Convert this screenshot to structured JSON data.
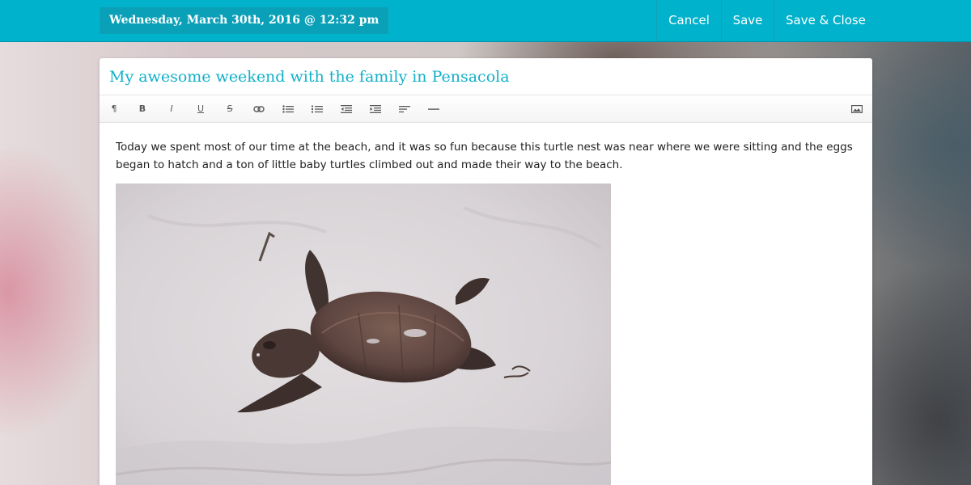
{
  "header": {
    "date": "Wednesday, March 30th, 2016 @ 12:32 pm",
    "cancel_label": "Cancel",
    "save_label": "Save",
    "save_close_label": "Save & Close",
    "accent_color": "#00b2cc"
  },
  "editor": {
    "title": "My awesome weekend with the family in Pensacola",
    "title_color": "#12b0c8",
    "toolbar": {
      "paragraph_glyph": "¶",
      "bold_glyph": "B",
      "italic_glyph": "I",
      "underline_glyph": "U",
      "strike_glyph": "S",
      "icons": [
        "paragraph-icon",
        "bold-icon",
        "italic-icon",
        "underline-icon",
        "strikethrough-icon",
        "link-icon",
        "unordered-list-icon",
        "ordered-list-icon",
        "outdent-icon",
        "indent-icon",
        "align-left-icon",
        "horizontal-rule-icon",
        "image-icon"
      ]
    },
    "body": "Today we spent most of our time at the beach, and it was so fun because this turtle nest was near where we were sitting and the eggs began to hatch and a ton of little baby turtles climbed out and made their way to the beach."
  }
}
